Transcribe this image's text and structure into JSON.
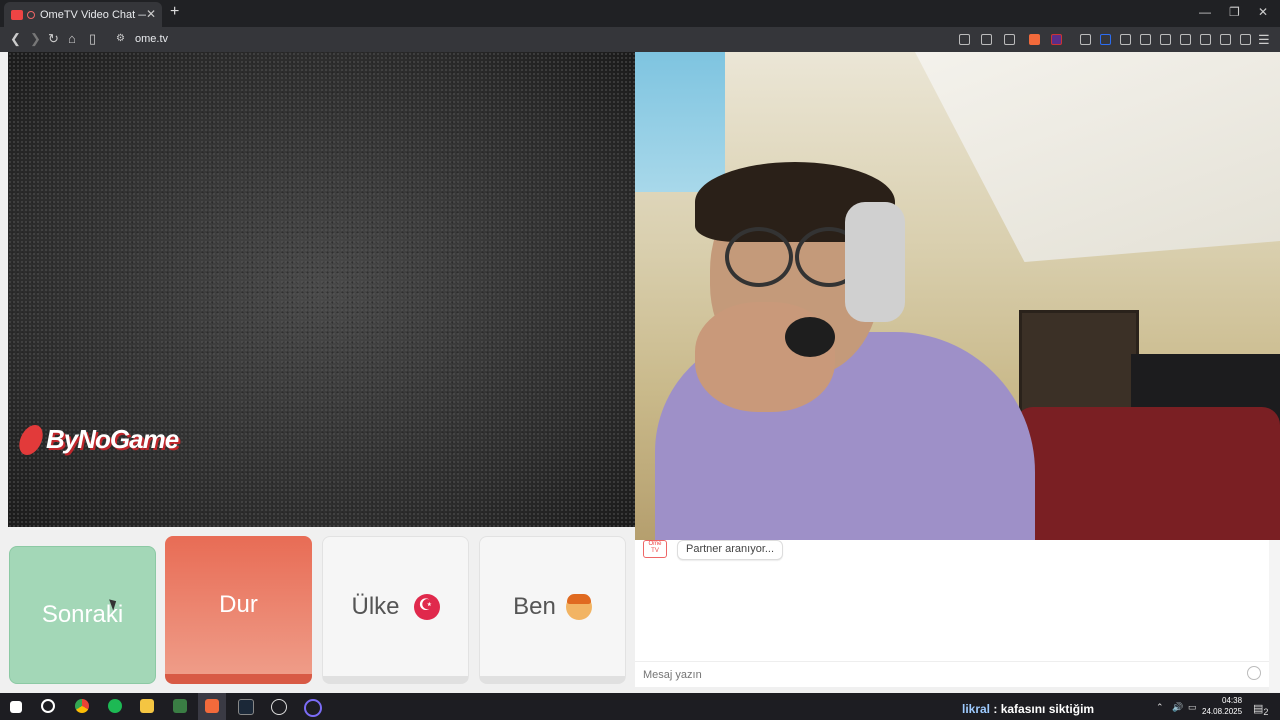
{
  "browser": {
    "tab_title": "OmeTV Video Chat — Omegle",
    "new_tab": "+",
    "tab_close": "✕",
    "url": "ome.tv",
    "minimize": "—",
    "restore": "❐",
    "close": "✕"
  },
  "video": {
    "watermark": "ByNoGame"
  },
  "controls": {
    "next_label": "Sonraki",
    "stop_label": "Dur",
    "country_label": "Ülke",
    "me_label": "Ben"
  },
  "chat": {
    "logo_text": "Ome TV",
    "status_message": "Partner aranıyor...",
    "input_placeholder": "Mesaj yazın"
  },
  "taskbar": {
    "overlay_user": "likral",
    "overlay_message": ": kafasını siktiğim",
    "time": "04:38",
    "date": "24.08.2025",
    "notifications": "2"
  },
  "colors": {
    "next_button": "#a3d7b7",
    "stop_button": "#e86c55",
    "country_flag": "#e0294c"
  }
}
